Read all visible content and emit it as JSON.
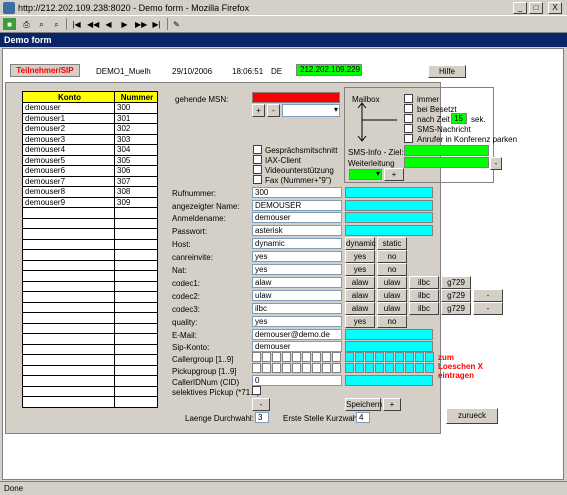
{
  "window": {
    "title": "http://212.202.109.238:8020 - Demo form - Mozilla Firefox",
    "min": "_",
    "max": "□",
    "close": "X"
  },
  "form_title": "Demo form",
  "header": {
    "tab": "Teilnehmer/SIP",
    "user": "DEMO1_Muelh",
    "date": "29/10/2006",
    "time": "18:06:51",
    "lang": "DE",
    "ip": "212.202.109.229",
    "help": "Hilfe"
  },
  "konto": {
    "headers": [
      "Konto",
      "Nummer"
    ],
    "rows": [
      [
        "demouser",
        "300"
      ],
      [
        "demouser1",
        "301"
      ],
      [
        "demouser2",
        "302"
      ],
      [
        "demouser3",
        "303"
      ],
      [
        "demouser4",
        "304"
      ],
      [
        "demouser5",
        "305"
      ],
      [
        "demouser6",
        "306"
      ],
      [
        "demouser7",
        "307"
      ],
      [
        "demouser8",
        "308"
      ],
      [
        "demouser9",
        "309"
      ]
    ]
  },
  "msn": {
    "label": "gehende MSN:",
    "plus": "+",
    "minus": "-"
  },
  "mailbox": {
    "title": "Mailbox",
    "opts": [
      "immer",
      "bei Besetzt",
      "nach Zeit",
      "SMS-Nachricht",
      "Anrufer in Konferenz parken"
    ],
    "zeit": "15",
    "sek": "sek.",
    "sms_label": "SMS-Info - Ziel:",
    "weiter": "Weiterleitung",
    "minus": "-",
    "plus": "+"
  },
  "checks": [
    "Gesprächsmitschnitt",
    "IAX-Client",
    "Videounterstützung",
    "Fax (Nummer+\"9\")"
  ],
  "fields": {
    "rufnummer": {
      "label": "Rufnummer:",
      "value": "300"
    },
    "anzeigename": {
      "label": "angezeigter Name:",
      "value": "DEMOUSER"
    },
    "anmeldename": {
      "label": "Anmeldename:",
      "value": "demouser"
    },
    "passwort": {
      "label": "Passwort:",
      "value": "asterisk"
    },
    "host": {
      "label": "Host:",
      "value": "dynamic"
    },
    "canreinvite": {
      "label": "canreinvite:",
      "value": "yes"
    },
    "nat": {
      "label": "Nat:",
      "value": "yes"
    },
    "codec1": {
      "label": "codec1:",
      "value": "alaw"
    },
    "codec2": {
      "label": "codec2:",
      "value": "ulaw"
    },
    "codec3": {
      "label": "codec3:",
      "value": "ilbc"
    },
    "quality": {
      "label": "quality:",
      "value": "yes"
    },
    "email": {
      "label": "E-Mail:",
      "value": "demouser@demo.de"
    },
    "sipkonto": {
      "label": "Sip-Konto:",
      "value": "demouser"
    },
    "callergroup": {
      "label": "Callergroup [1..9]"
    },
    "pickupgroup": {
      "label": "Pickupgroup [1..9]"
    },
    "callerid": {
      "label": "CallerIDNum (CID)",
      "value": "0"
    },
    "selpickup": {
      "label": "selektives Pickup (*71...)"
    }
  },
  "opt": {
    "dynamic": "dynamic",
    "static": "static",
    "yes": "yes",
    "no": "no",
    "alaw": "alaw",
    "ulaw": "ulaw",
    "ilbc": "ilbc",
    "g729": "g729",
    "minus": "-"
  },
  "note": [
    "zum",
    "Loeschen X",
    "eintragen"
  ],
  "bottom": {
    "minus": "-",
    "speichern": "Speichern",
    "plus": "+",
    "laenge_label": "Laenge Durchwahl:",
    "laenge": "3",
    "erste_label": "Erste Stelle Kurzwahl:",
    "erste": "4",
    "zurueck": "zurueck"
  },
  "status": "Done",
  "colors": {
    "accent": "#0a246a",
    "red_text": "#ff0000",
    "cyan": "#00ffff",
    "green": "#00ff00",
    "yellow": "#ffff00"
  }
}
